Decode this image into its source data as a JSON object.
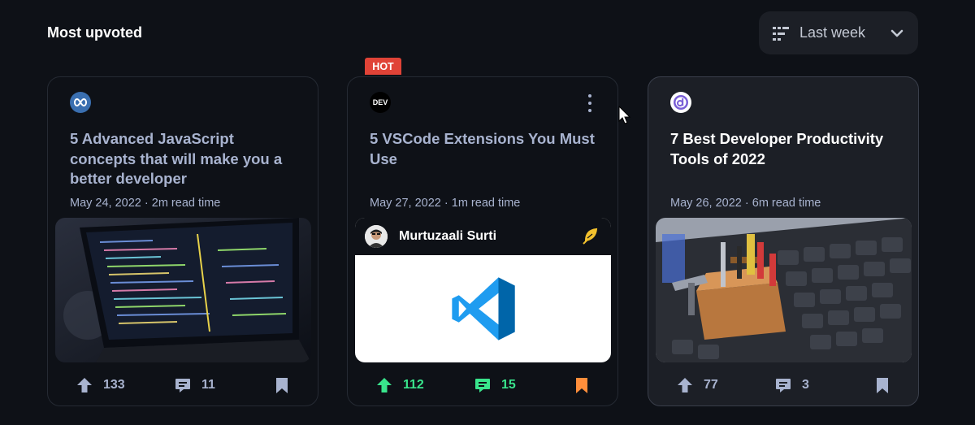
{
  "section": {
    "title": "Most upvoted"
  },
  "period_select": {
    "value": "Last week",
    "icon": "filter-icon",
    "chevron": "chevron-down-icon"
  },
  "colors": {
    "background": "#0e1117",
    "card_highlight": "#1c1f26",
    "upvote_active": "#39e58c",
    "comment_active": "#39e58c",
    "bookmark_active": "#ff8e3b",
    "hot": "#e04337",
    "muted": "#a8b3cf"
  },
  "cards": [
    {
      "source_icon": "infinity-logo-icon",
      "title": "5 Advanced JavaScript concepts that will make you a better developer",
      "meta": "May 24, 2022 · 2m read time",
      "image": "laptop-code-image",
      "upvotes": "133",
      "comments": "11"
    },
    {
      "badge": "HOT",
      "source_icon": "dev-logo-icon",
      "source_text": "DEV",
      "title": "5 VSCode Extensions You Must Use",
      "meta": "May 27, 2022 · 1m read time",
      "author": "Murtuzaali Surti",
      "author_icon": "feather-icon",
      "image": "vscode-logo-icon",
      "upvotes": "112",
      "comments": "15",
      "upvoted": true,
      "commented": true,
      "bookmarked": true
    },
    {
      "source_icon": "d-logo-icon",
      "title": "7 Best Developer Productivity Tools of 2022",
      "meta": "May 26, 2022 · 6m read time",
      "image": "toolbox-keyboard-image",
      "upvotes": "77",
      "comments": "3"
    }
  ]
}
